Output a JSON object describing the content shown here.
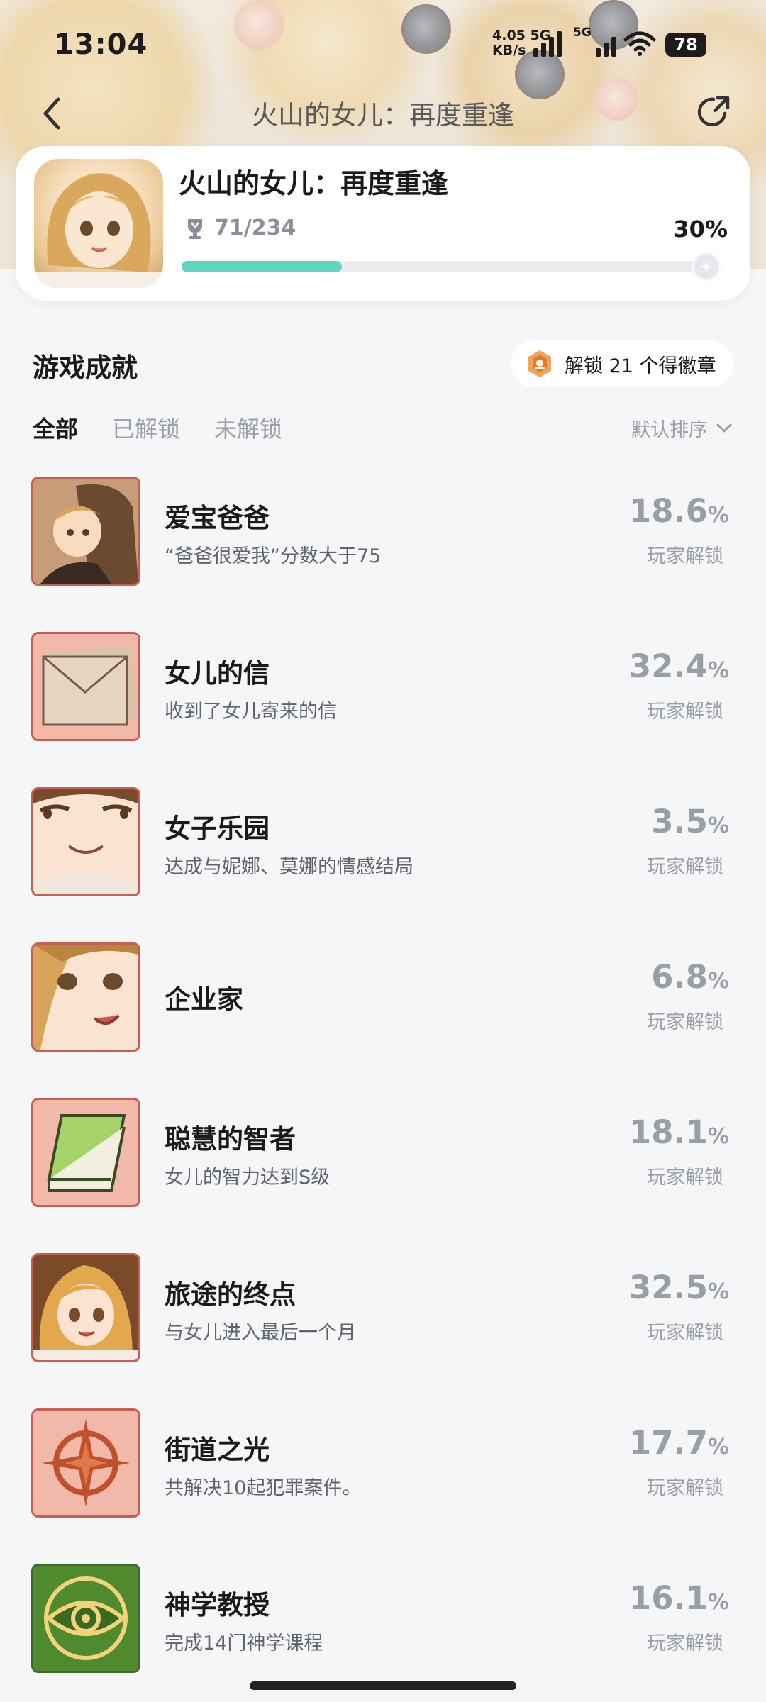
{
  "status_bar": {
    "time": "13:04",
    "net_speed_value": "4.05",
    "net_speed_unit": "KB/s",
    "net_top": "5G",
    "sim1_label": "5G",
    "sim2_label": "5G",
    "battery": "78"
  },
  "header": {
    "title": "火山的女儿：再度重逢"
  },
  "game": {
    "name": "火山的女儿：再度重逢",
    "achieved_count": "71/234",
    "percent_label": "30%",
    "progress": 0.3
  },
  "section": {
    "title": "游戏成就",
    "badge_text": "解锁 21 个得徽章"
  },
  "filters": {
    "tabs": [
      "全部",
      "已解锁",
      "未解锁"
    ],
    "selected_index": 0,
    "sort_label": "默认排序"
  },
  "achievements": [
    {
      "title": "爱宝爸爸",
      "desc": "“爸爸很爱我”分数大于75",
      "percent": "18.6",
      "unit": "%",
      "label": "玩家解锁",
      "icon": "father-holding-daughter-icon"
    },
    {
      "title": "女儿的信",
      "desc": "收到了女儿寄来的信",
      "percent": "32.4",
      "unit": "%",
      "label": "玩家解锁",
      "icon": "envelope-icon"
    },
    {
      "title": "女子乐园",
      "desc": "达成与妮娜、莫娜的情感结局",
      "percent": "3.5",
      "unit": "%",
      "label": "玩家解锁",
      "icon": "smiling-face-icon"
    },
    {
      "title": "企业家",
      "desc": "",
      "percent": "6.8",
      "unit": "%",
      "label": "玩家解锁",
      "icon": "girl-face-icon"
    },
    {
      "title": "聪慧的智者",
      "desc": "女儿的智力达到S级",
      "percent": "18.1",
      "unit": "%",
      "label": "玩家解锁",
      "icon": "green-book-icon"
    },
    {
      "title": "旅途的终点",
      "desc": "与女儿进入最后一个月",
      "percent": "32.5",
      "unit": "%",
      "label": "玩家解锁",
      "icon": "girl-portrait-icon"
    },
    {
      "title": "街道之光",
      "desc": "共解决10起犯罪案件。",
      "percent": "17.7",
      "unit": "%",
      "label": "玩家解锁",
      "icon": "compass-star-icon"
    },
    {
      "title": "神学教授",
      "desc": "完成14门神学课程",
      "percent": "16.1",
      "unit": "%",
      "label": "玩家解锁",
      "icon": "eye-symbol-icon"
    }
  ]
}
